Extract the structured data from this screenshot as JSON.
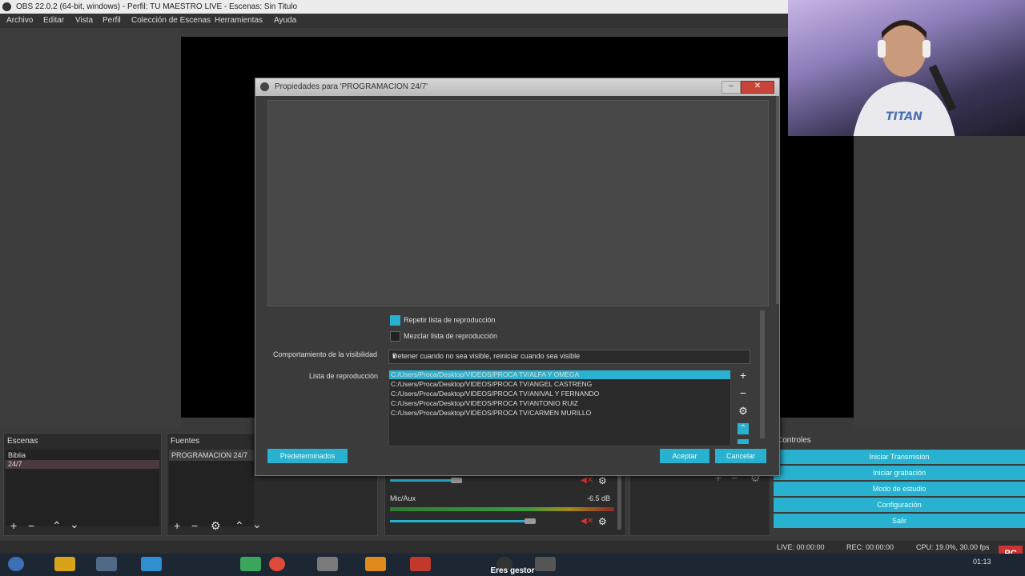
{
  "window": {
    "title": "OBS 22.0.2 (64-bit, windows) - Perfil: TU MAESTRO LIVE - Escenas: Sin Titulo"
  },
  "menu": [
    "Archivo",
    "Editar",
    "Vista",
    "Perfil",
    "Colección de Escenas",
    "Herramientas",
    "Ayuda"
  ],
  "scenes": {
    "title": "Escenas",
    "items": [
      "Biblia",
      "24/7"
    ]
  },
  "sources": {
    "title": "Fuentes",
    "items": [
      "PROGRAMACION 24/7"
    ]
  },
  "mixer": {
    "channel2_label": "Mic/Aux",
    "channel2_db": "-6.5 dB"
  },
  "controls": {
    "title": "Controles",
    "buttons": [
      "Iniciar Transmisión",
      "Iniciar grabación",
      "Modo de estudio",
      "Configuración",
      "Salir"
    ]
  },
  "status": {
    "live": "LIVE: 00:00:00",
    "rec": "REC: 00:00:00",
    "cpu": "CPU: 19.0%, 30.00 fps"
  },
  "taskbar": {
    "caption": "Eres gestor",
    "clock": "01:13"
  },
  "dialog": {
    "title": "Propiedades para 'PROGRAMACION 24/7'",
    "loop_label": "Repetir lista de reproducción",
    "loop_checked": true,
    "shuffle_label": "Mezclar lista de reproducción",
    "shuffle_checked": false,
    "visibility_label": "Comportamiento de la visibilidad",
    "visibility_value": "Detener cuando no sea visible, reiniciar cuando sea visible",
    "playlist_label": "Lista de reproducción",
    "playlist": [
      "C:/Users/Proca/Desktop/VIDEOS/PROCA TV/ALFA Y OMEGA",
      "C:/Users/Proca/Desktop/VIDEOS/PROCA TV/ANGEL CASTRENG",
      "C:/Users/Proca/Desktop/VIDEOS/PROCA TV/ANIVAL Y FERNANDO",
      "C:/Users/Proca/Desktop/VIDEOS/PROCA TV/ANTONIO RUIZ",
      "C:/Users/Proca/Desktop/VIDEOS/PROCA TV/CARMEN MURILLO"
    ],
    "defaults_button": "Predeterminados",
    "accept_button": "Aceptar",
    "cancel_button": "Cancelar"
  },
  "colors": {
    "accent": "#28b2cf",
    "panel": "#2b2b2b",
    "background": "#3a3a3a"
  }
}
